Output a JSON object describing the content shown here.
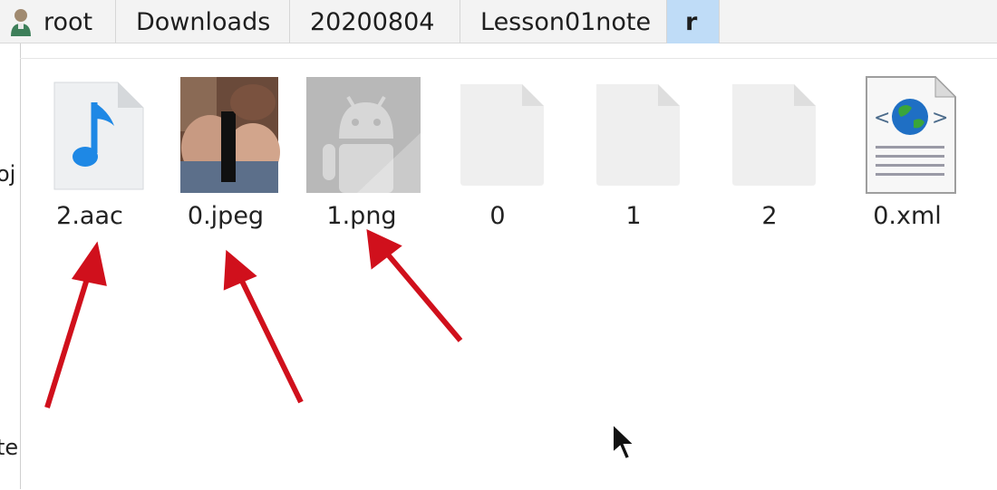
{
  "breadcrumb": {
    "items": [
      {
        "label": "root",
        "icon": "user-icon"
      },
      {
        "label": "Downloads"
      },
      {
        "label": "20200804"
      },
      {
        "label": "Lesson01note"
      },
      {
        "label": "r",
        "active": true
      }
    ]
  },
  "left_pane": {
    "fragments": [
      "oj",
      "te"
    ]
  },
  "files": [
    {
      "name": "2.aac",
      "icon": "audio-file-icon"
    },
    {
      "name": "0.jpeg",
      "icon": "image-thumbnail"
    },
    {
      "name": "1.png",
      "icon": "android-image-thumbnail"
    },
    {
      "name": "0",
      "icon": "blank-file-icon"
    },
    {
      "name": "1",
      "icon": "blank-file-icon"
    },
    {
      "name": "2",
      "icon": "blank-file-icon"
    },
    {
      "name": "0.xml",
      "icon": "xml-web-file-icon"
    }
  ],
  "colors": {
    "annotation_arrow": "#d0101c",
    "active_crumb": "#bfdcf7",
    "audio_note": "#1e88e5"
  }
}
